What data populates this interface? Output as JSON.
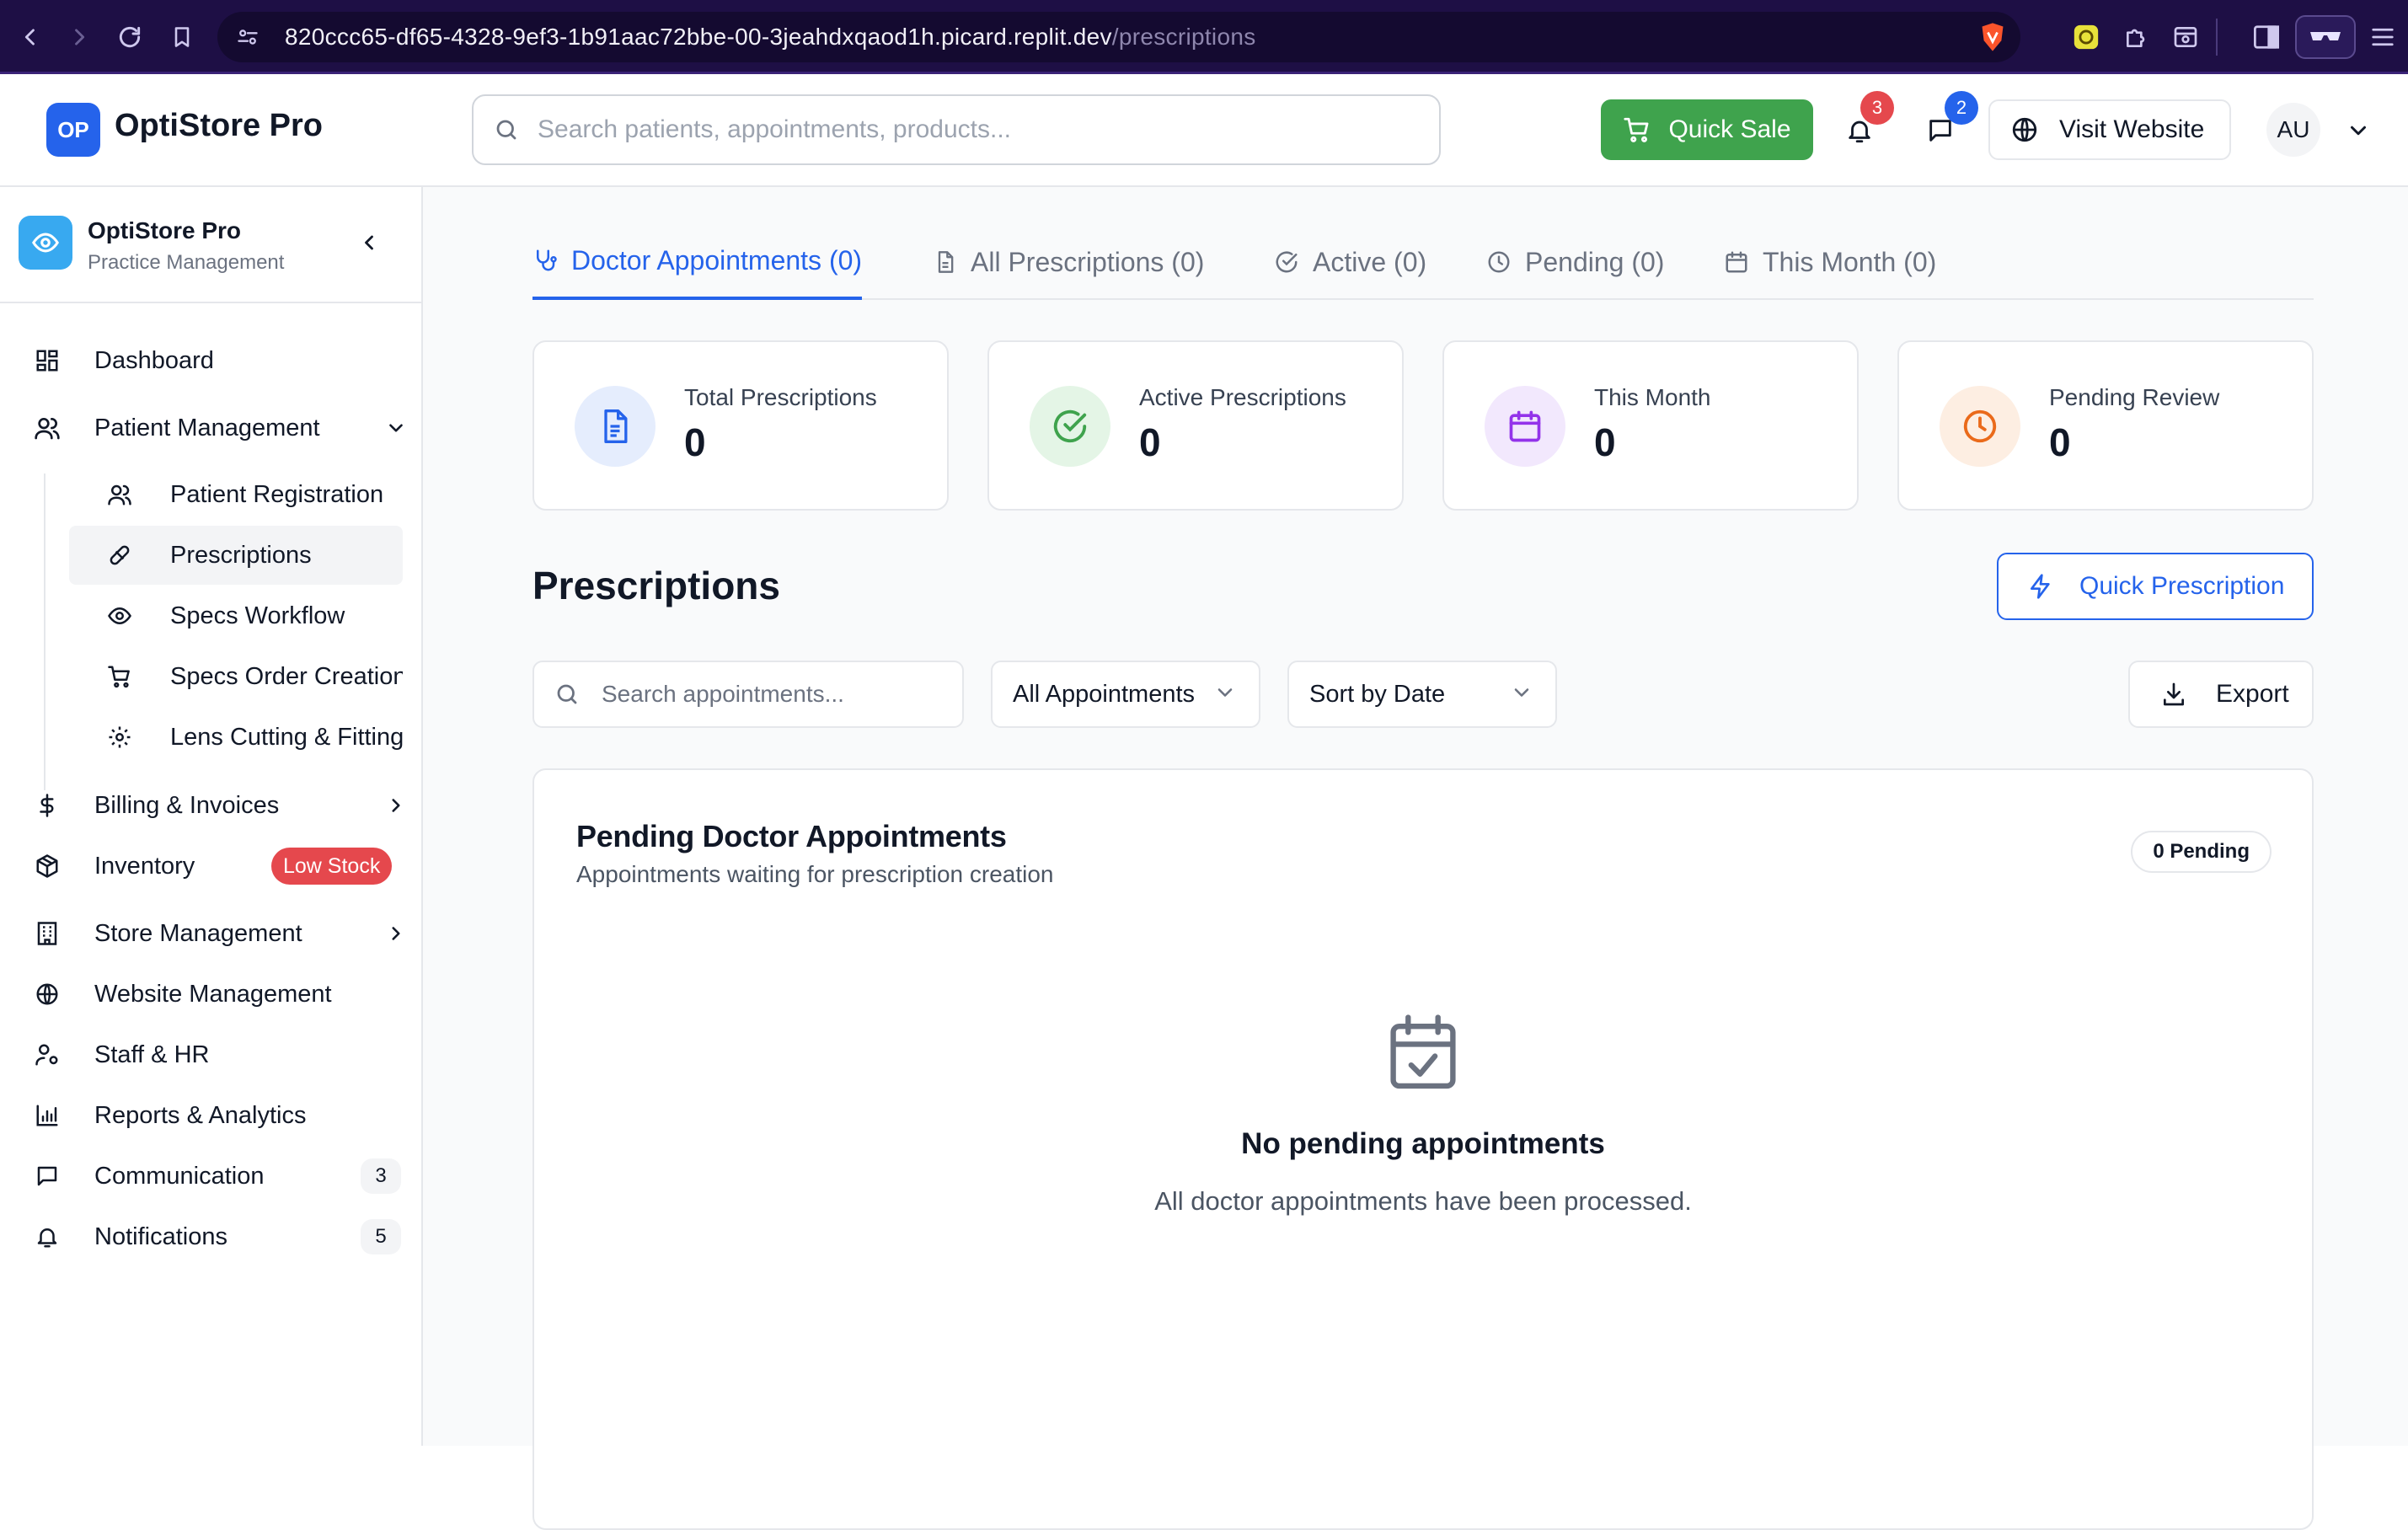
{
  "browser": {
    "url_host": "820ccc65-df65-4328-9ef3-1b91aac72bbe-00-3jeahdxqaod1h.picard.replit.dev",
    "url_path": "/prescriptions"
  },
  "header": {
    "logo_initials": "OP",
    "app_name": "OptiStore Pro",
    "search_placeholder": "Search patients, appointments, products...",
    "quick_sale_label": "Quick Sale",
    "notifications_count": "3",
    "messages_count": "2",
    "visit_website_label": "Visit Website",
    "avatar_initials": "AU"
  },
  "sidebar": {
    "title": "OptiStore Pro",
    "subtitle": "Practice Management",
    "items": [
      {
        "label": "Dashboard",
        "icon": "dashboard-icon"
      },
      {
        "label": "Patient Management",
        "icon": "users-icon",
        "expanded": true
      },
      {
        "label": "Billing & Invoices",
        "icon": "dollar-icon"
      },
      {
        "label": "Inventory",
        "icon": "package-icon",
        "badge": "Low Stock"
      },
      {
        "label": "Store Management",
        "icon": "building-icon"
      },
      {
        "label": "Website Management",
        "icon": "globe-icon"
      },
      {
        "label": "Staff & HR",
        "icon": "user-cog-icon"
      },
      {
        "label": "Reports & Analytics",
        "icon": "bar-chart-icon"
      },
      {
        "label": "Communication",
        "icon": "message-icon",
        "badge": "3"
      },
      {
        "label": "Notifications",
        "icon": "bell-icon",
        "badge": "5"
      }
    ],
    "sub_items": [
      {
        "label": "Patient Registration",
        "icon": "users-icon"
      },
      {
        "label": "Prescriptions",
        "icon": "pill-icon",
        "active": true
      },
      {
        "label": "Specs Workflow",
        "icon": "eye-icon"
      },
      {
        "label": "Specs Order Creation",
        "icon": "cart-icon"
      },
      {
        "label": "Lens Cutting & Fitting",
        "icon": "gear-icon"
      }
    ]
  },
  "tabs": [
    {
      "label": "Doctor Appointments (0)",
      "active": true
    },
    {
      "label": "All Prescriptions (0)"
    },
    {
      "label": "Active (0)"
    },
    {
      "label": "Pending (0)"
    },
    {
      "label": "This Month (0)"
    }
  ],
  "stats": [
    {
      "label": "Total Prescriptions",
      "value": "0",
      "color": "#2563eb",
      "bg": "#e5edfd"
    },
    {
      "label": "Active Prescriptions",
      "value": "0",
      "color": "#3fa34d",
      "bg": "#e4f5e6"
    },
    {
      "label": "This Month",
      "value": "0",
      "color": "#9333ea",
      "bg": "#f2e8fd"
    },
    {
      "label": "Pending Review",
      "value": "0",
      "color": "#ea6a1a",
      "bg": "#fdeee2"
    }
  ],
  "page": {
    "title": "Prescriptions",
    "quick_prescription_label": "Quick Prescription",
    "filter_search_placeholder": "Search appointments...",
    "filter_type_value": "All Appointments",
    "sort_value": "Sort by Date",
    "export_label": "Export"
  },
  "card": {
    "title": "Pending Doctor Appointments",
    "subtitle": "Appointments waiting for prescription creation",
    "badge": "0 Pending",
    "empty_title": "No pending appointments",
    "empty_subtitle": "All doctor appointments have been processed."
  },
  "colors": {
    "accent": "#2563eb",
    "quick_sale_green": "#3fa34d",
    "notification_badge": "#e5484d",
    "browser_bar": "#1e0f45"
  }
}
